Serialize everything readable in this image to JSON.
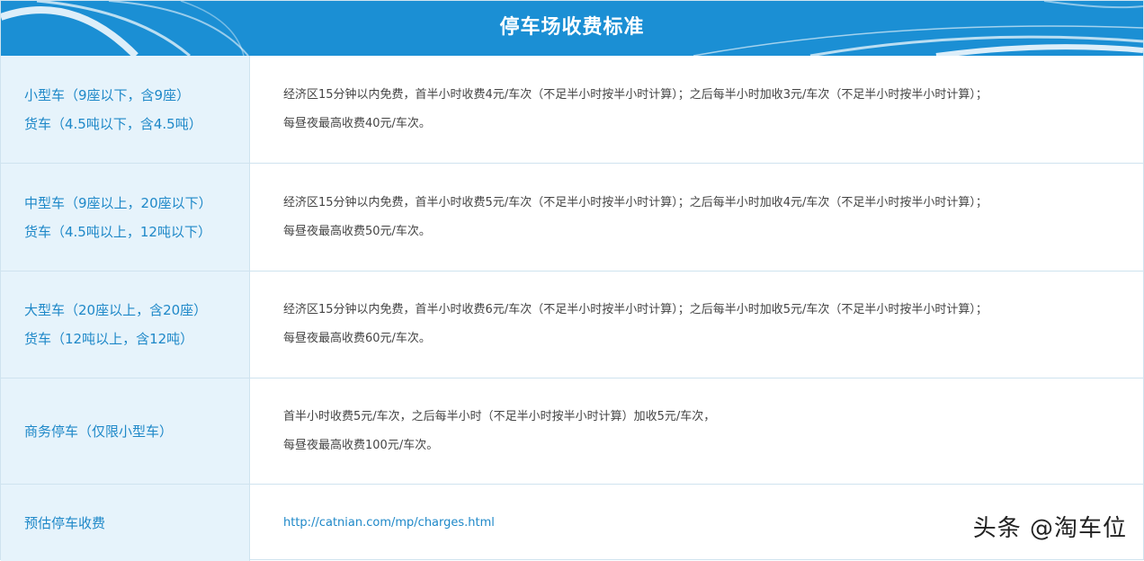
{
  "header": {
    "title": "停车场收费标准"
  },
  "rows": [
    {
      "left": [
        "小型车（9座以下，含9座）",
        "货车（4.5吨以下，含4.5吨）"
      ],
      "right": [
        "经济区15分钟以内免费，首半小时收费4元/车次（不足半小时按半小时计算）；之后每半小时加收3元/车次（不足半小时按半小时计算）；",
        "每昼夜最高收费40元/车次。"
      ]
    },
    {
      "left": [
        "中型车（9座以上，20座以下）",
        "货车（4.5吨以上，12吨以下）"
      ],
      "right": [
        "经济区15分钟以内免费，首半小时收费5元/车次（不足半小时按半小时计算）；之后每半小时加收4元/车次（不足半小时按半小时计算）；",
        "每昼夜最高收费50元/车次。"
      ]
    },
    {
      "left": [
        "大型车（20座以上，含20座）",
        "货车（12吨以上，含12吨）"
      ],
      "right": [
        "经济区15分钟以内免费，首半小时收费6元/车次（不足半小时按半小时计算）；之后每半小时加收5元/车次（不足半小时按半小时计算）；",
        "每昼夜最高收费60元/车次。"
      ]
    },
    {
      "left": [
        "商务停车（仅限小型车）"
      ],
      "right": [
        "首半小时收费5元/车次，之后每半小时（不足半小时按半小时计算）加收5元/车次，",
        "每昼夜最高收费100元/车次。"
      ]
    },
    {
      "left": [
        "预估停车收费"
      ],
      "link": "http://catnian.com/mp/charges.html"
    }
  ],
  "watermark": "头条 @淘车位",
  "colors": {
    "header_bg": "#1b8fd4",
    "left_bg": "#e6f3fb",
    "accent_text": "#1e88c8",
    "body_text": "#444444",
    "border": "#cfe3ef"
  }
}
